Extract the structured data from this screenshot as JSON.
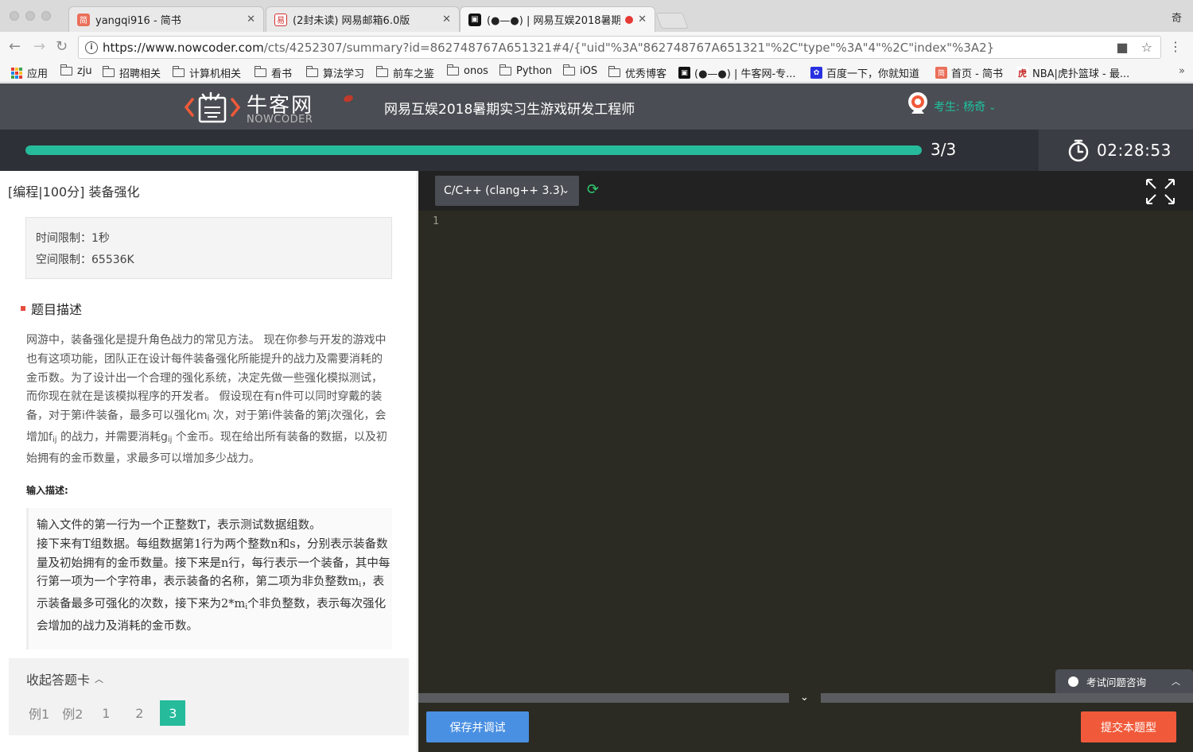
{
  "browser": {
    "tabs": [
      {
        "title": "yangqi916 - 简书",
        "favicon": "简",
        "favicon_color": "#ea6f5a"
      },
      {
        "title": "(2封未读) 网易邮箱6.0版",
        "favicon": "易",
        "favicon_color": "#d32f2f"
      },
      {
        "title": "(●—●) | 网易互娱2018暑期",
        "favicon": "",
        "favicon_color": "#111111"
      }
    ],
    "profile": "奇",
    "url_host": "https://www.nowcoder.com",
    "url_path": "/cts/4252307/summary?id=862748767A651321#4/{\"uid\"%3A\"862748767A651321\"%2C\"type\"%3A\"4\"%2C\"index\"%3A2}",
    "bookmarks": [
      {
        "label": "应用",
        "kind": "apps"
      },
      {
        "label": "zju",
        "kind": "folder"
      },
      {
        "label": "招聘相关",
        "kind": "folder"
      },
      {
        "label": "计算机相关",
        "kind": "folder"
      },
      {
        "label": "看书",
        "kind": "folder"
      },
      {
        "label": "算法学习",
        "kind": "folder"
      },
      {
        "label": "前车之鉴",
        "kind": "folder"
      },
      {
        "label": "onos",
        "kind": "folder"
      },
      {
        "label": "Python",
        "kind": "folder"
      },
      {
        "label": "iOS",
        "kind": "folder"
      },
      {
        "label": "优秀博客",
        "kind": "folder"
      },
      {
        "label": "(●—●) | 牛客网-专...",
        "kind": "site",
        "color": "#111111"
      },
      {
        "label": "百度一下，你就知道",
        "kind": "site",
        "color": "#2932e1"
      },
      {
        "label": "首页 - 简书",
        "kind": "site",
        "color": "#ea6f5a"
      },
      {
        "label": "NBA|虎扑篮球 - 最...",
        "kind": "site",
        "color": "#c62828"
      }
    ],
    "bookmarks_more": "»"
  },
  "header": {
    "logo_text": "牛客网",
    "logo_sub": "NOWCODER",
    "exam_title": "网易互娱2018暑期实习生游戏研发工程师",
    "user_label": "考生: 杨奇"
  },
  "progress": {
    "text": "3/3",
    "fraction": 1.0,
    "timer": "02:28:53"
  },
  "question": {
    "title": "[编程|100分] 装备强化",
    "time_limit": "时间限制：1秒",
    "space_limit": "空间限制：65536K",
    "section_title": "题目描述",
    "desc_part1": "网游中，装备强化是提升角色战力的常见方法。 现在你参与开发的游戏中也有这项功能，团队正在设计每件装备强化所能提升的战力及需要消耗的金币数。为了设计出一个合理的强化系统，决定先做一些强化模拟测试，而你现在就在是该模拟程序的开发者。 假设现在有n件可以同时穿戴的装备，对于第i件装备，最多可以强化m",
    "desc_sub_i": "i",
    "desc_part2": " 次，对于第i件装备的第j次强化，会增加f",
    "desc_sub_ij1": "ij",
    "desc_part3": " 的战力，并需要消耗g",
    "desc_sub_ij2": "ij",
    "desc_part4": " 个金币。现在给出所有装备的数据，以及初始拥有的金币数量，求最多可以增加多少战力。",
    "input_label": "输入描述:",
    "input_part1": "输入文件的第一行为一个正整数T，表示测试数据组数。\n接下来有T组数据。每组数据第1行为两个整数n和s，分别表示装备数量及初始拥有的金币数量。接下来是n行，每行表示一个装备，其中每行第一项为一个字符串，表示装备的名称，第二项为非负整数m",
    "input_sub1": "i",
    "input_part2": "，表示装备最多可强化的次数，接下来为2*m",
    "input_sub2": "i",
    "input_part3": "个非负整数，表示每次强化会增加的战力及消耗的金币数。"
  },
  "answer_card": {
    "toggle_label": "收起答题卡",
    "items": [
      "例1",
      "例2",
      "1",
      "2",
      "3"
    ],
    "current": "3"
  },
  "editor": {
    "language": "C/C++ (clang++ 3.3)",
    "line_number": "1",
    "save_button": "保存并调试",
    "submit_button": "提交本题型",
    "help_label": "考试问题咨询"
  }
}
